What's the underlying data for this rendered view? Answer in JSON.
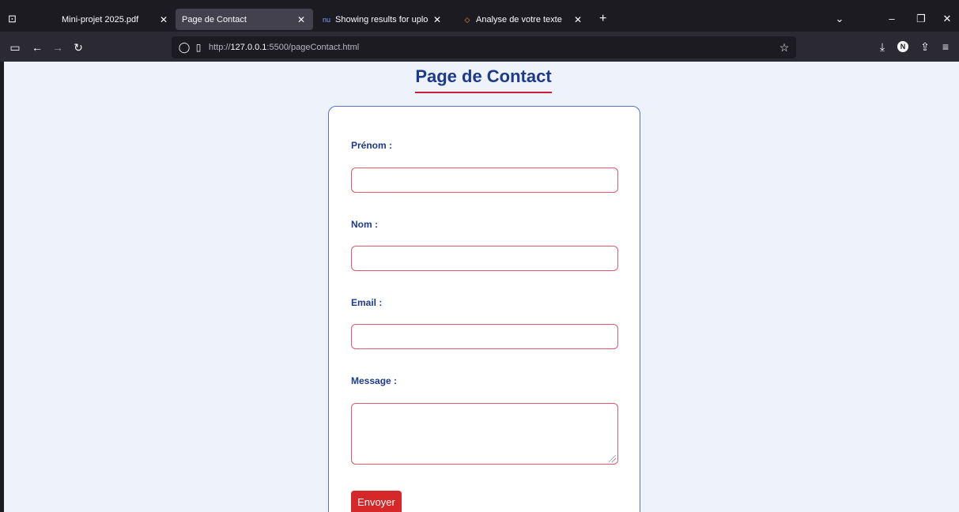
{
  "browser": {
    "tabs": [
      {
        "label": "Mini-projet 2025.pdf",
        "icon": "pdf-icon"
      },
      {
        "label": "Page de Contact",
        "icon": "page-icon",
        "active": true
      },
      {
        "label": "Showing results for uploaded fi",
        "icon": "nu-favicon"
      },
      {
        "label": "Analyse de votre texte",
        "icon": "code-favicon"
      }
    ],
    "favicon_text": "nu",
    "url_prefix": "http://",
    "url_host": "127.0.0.1",
    "url_rest": ":5500/pageContact.html",
    "avatar_letter": "N"
  },
  "page": {
    "title": "Page de Contact"
  },
  "form": {
    "fields": [
      {
        "label": "Prénom :",
        "value": ""
      },
      {
        "label": "Nom :",
        "value": ""
      },
      {
        "label": "Email :",
        "value": ""
      },
      {
        "label": "Message :",
        "value": ""
      }
    ],
    "submit_label": "Envoyer"
  },
  "colors": {
    "title": "#1e3a8a",
    "accent": "#c81e3a",
    "button": "#d62828",
    "background": "#eef2fb"
  }
}
